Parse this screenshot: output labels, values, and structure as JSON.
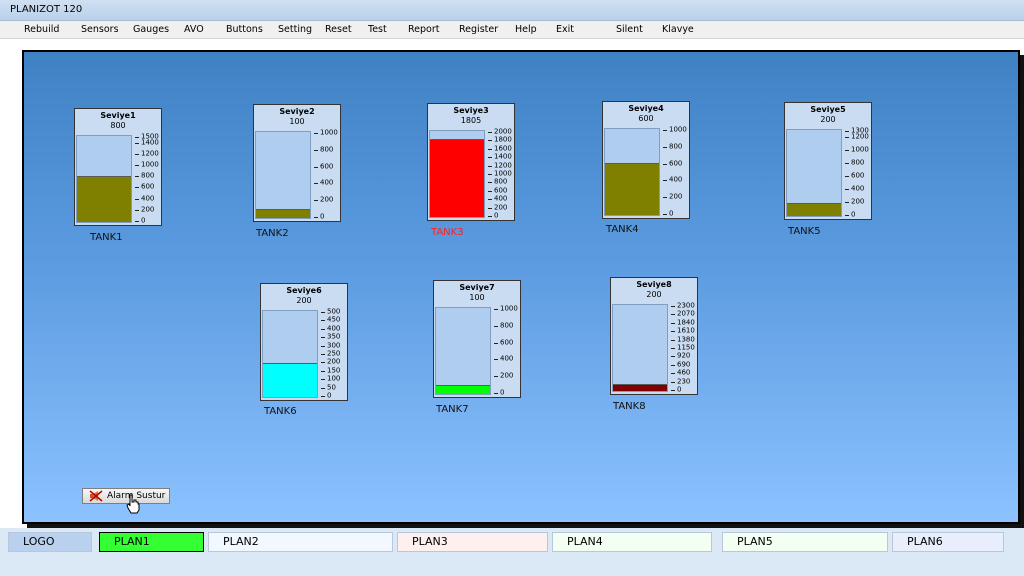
{
  "window": {
    "title": "PLANIZOT  120"
  },
  "menu": [
    "Rebuild",
    "Sensors",
    "Gauges",
    "AVO",
    "Buttons",
    "Setting",
    "Reset",
    "Test",
    "Report",
    "Register",
    "Help",
    "Exit",
    "Silent",
    "Klavye"
  ],
  "gauges": [
    {
      "name": "Seviye1",
      "value": "800",
      "max": 1500,
      "level": 800,
      "ticks": [
        "1500",
        "1400",
        "1200",
        "1000",
        "800",
        "600",
        "400",
        "200",
        "0"
      ],
      "fill": "#808000",
      "tank": "TANK1",
      "alarm": false
    },
    {
      "name": "Seviye2",
      "value": "100",
      "max": 1000,
      "level": 100,
      "ticks": [
        "1000",
        "800",
        "600",
        "400",
        "200",
        "0"
      ],
      "fill": "#808000",
      "tank": "TANK2",
      "alarm": false
    },
    {
      "name": "Seviye3",
      "value": "1805",
      "max": 2000,
      "level": 1805,
      "ticks": [
        "2000",
        "1800",
        "1600",
        "1400",
        "1200",
        "1000",
        "800",
        "600",
        "400",
        "200",
        "0"
      ],
      "fill": "#ff0000",
      "tank": "TANK3",
      "alarm": true
    },
    {
      "name": "Seviye4",
      "value": "600",
      "max": 1000,
      "level": 600,
      "ticks": [
        "1000",
        "800",
        "600",
        "400",
        "200",
        "0"
      ],
      "fill": "#808000",
      "tank": "TANK4",
      "alarm": false
    },
    {
      "name": "Seviye5",
      "value": "200",
      "max": 1300,
      "level": 200,
      "ticks": [
        "1300",
        "1200",
        "1000",
        "800",
        "600",
        "400",
        "200",
        "0"
      ],
      "fill": "#808000",
      "tank": "TANK5",
      "alarm": false
    },
    {
      "name": "Seviye6",
      "value": "200",
      "max": 500,
      "level": 200,
      "ticks": [
        "500",
        "450",
        "400",
        "350",
        "300",
        "250",
        "200",
        "150",
        "100",
        "50",
        "0"
      ],
      "fill": "#00ffff",
      "tank": "TANK6",
      "alarm": false
    },
    {
      "name": "Seviye7",
      "value": "100",
      "max": 1000,
      "level": 100,
      "ticks": [
        "1000",
        "800",
        "600",
        "400",
        "200",
        "0"
      ],
      "fill": "#00ff00",
      "tank": "TANK7",
      "alarm": false
    },
    {
      "name": "Seviye8",
      "value": "200",
      "max": 2300,
      "level": 200,
      "ticks": [
        "2300",
        "2070",
        "1840",
        "1610",
        "1380",
        "1150",
        "920",
        "690",
        "460",
        "230",
        "0"
      ],
      "fill": "#800000",
      "tank": "TANK8",
      "alarm": false
    }
  ],
  "alarm_button": {
    "label": "Alarm Sustur",
    "icon": "alarm-mute-icon"
  },
  "plans": [
    {
      "label": "LOGO",
      "bg": "#b9d1ee"
    },
    {
      "label": "PLAN1",
      "bg": "#33ff33"
    },
    {
      "label": "PLAN2",
      "bg": "#f2f8ff"
    },
    {
      "label": "PLAN3",
      "bg": "#fff0f0"
    },
    {
      "label": "PLAN4",
      "bg": "#f2fff2"
    },
    {
      "label": "PLAN5",
      "bg": "#f2fff2"
    },
    {
      "label": "PLAN6",
      "bg": "#e8eefc"
    }
  ]
}
